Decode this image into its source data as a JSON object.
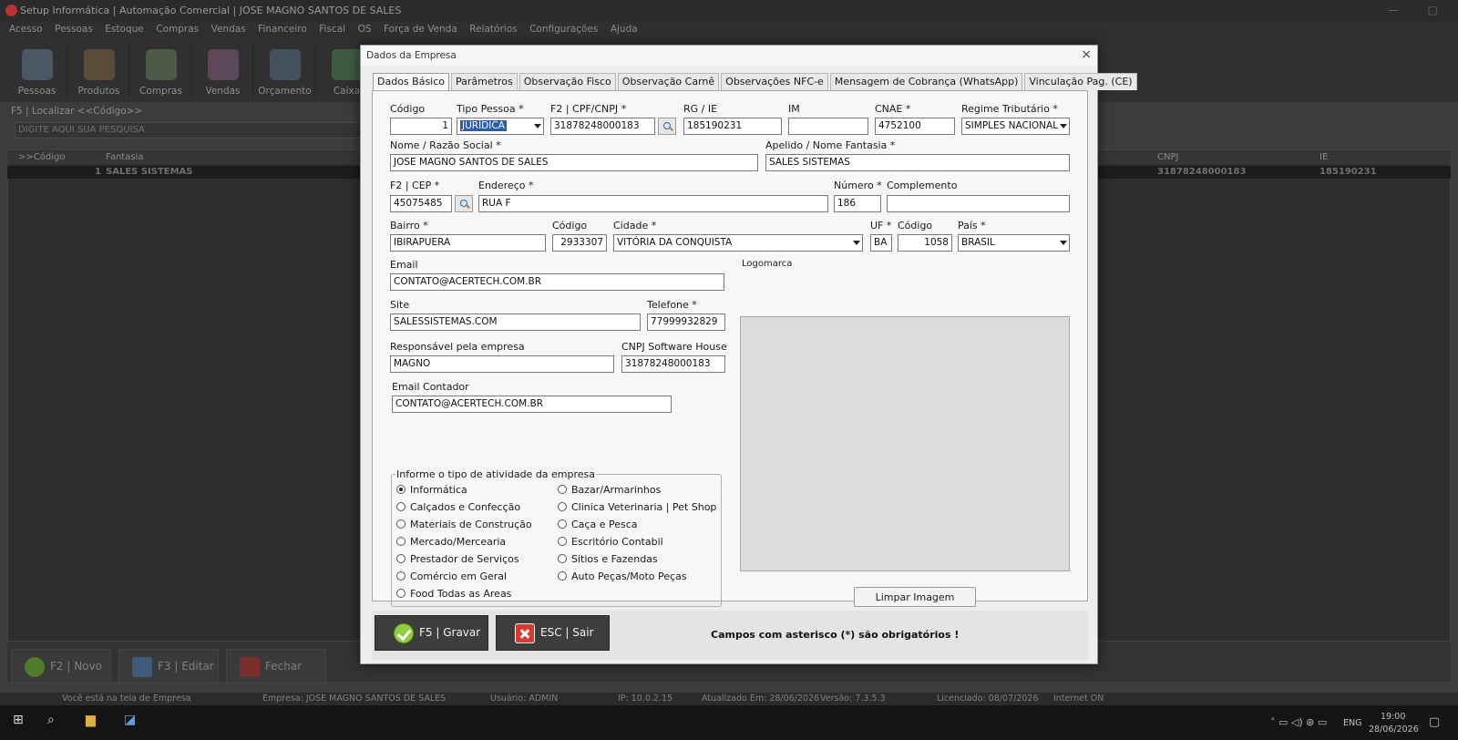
{
  "background_app": {
    "title": "Setup Informática | Automação Comercial | JOSE MAGNO SANTOS DE SALES",
    "window_buttons": "— ▢",
    "menu": [
      "Acesso",
      "Pessoas",
      "Estoque",
      "Compras",
      "Vendas",
      "Financeiro",
      "Fiscal",
      "OS",
      "Força de Venda",
      "Relatórios",
      "Configurações",
      "Ajuda"
    ],
    "toolbar": [
      "Pessoas",
      "Produtos",
      "Compras",
      "Vendas",
      "Orçamento",
      "Caixa"
    ],
    "search_label": "F5 | Localizar <<Código>>",
    "search_placeholder": "DIGITE AQUI SUA PESQUISA",
    "grid_headers": {
      "codigo": ">>Código",
      "fantasia": "Fantasia",
      "cnpj": "CNPJ",
      "ie": "IE"
    },
    "grid_row": {
      "codigo": "1",
      "fantasia": "SALES SISTEMAS",
      "cnpj": "31878248000183",
      "ie": "185190231"
    },
    "bottom_buttons": {
      "novo": "F2 | Novo",
      "editar": "F3 | Editar",
      "fechar": "Fechar"
    },
    "status": {
      "tela": "Você está na tela de Empresa",
      "empresa": "Empresa: JOSE MAGNO SANTOS DE SALES",
      "usuario": "Usuário: ADMIN",
      "ip": "IP: 10.0.2.15",
      "atualizado": "Atualizado Em: 28/06/2026",
      "versao": "Versão: 7.3.5.3",
      "licenciado": "Licenciado: 08/07/2026",
      "internet": "Internet ON"
    }
  },
  "taskbar": {
    "lang": "ENG",
    "time": "19:00",
    "date": "28/06/2026"
  },
  "dialog": {
    "title": "Dados da Empresa",
    "close": "×",
    "tabs": [
      "Dados Básico",
      "Parâmetros",
      "Observação Fisco",
      "Observação Carnê",
      "Observações NFC-e",
      "Mensagem de Cobrança (WhatsApp)",
      "Vinculação Pag. (CE)"
    ],
    "labels": {
      "codigo": "Código",
      "tipo_pessoa": "Tipo Pessoa *",
      "cpf_cnpj": "F2 | CPF/CNPJ *",
      "rg_ie": "RG / IE",
      "im": "IM",
      "cnae": "CNAE *",
      "regime": "Regime Tributário *",
      "razao": "Nome / Razão Social *",
      "fantasia": "Apelido / Nome Fantasia *",
      "cep": "F2 | CEP *",
      "endereco": "Endereço *",
      "numero": "Número *",
      "complemento": "Complemento",
      "bairro": "Bairro *",
      "cod_cidade": "Código",
      "cidade": "Cidade *",
      "uf": "UF *",
      "cod_pais": "Código",
      "pais": "País *",
      "email": "Email",
      "logomarca": "Logomarca",
      "site": "Site",
      "telefone": "Telefone *",
      "responsavel": "Responsável pela empresa",
      "cnpj_sh": "CNPJ Software House",
      "email_contador": "Email Contador"
    },
    "values": {
      "codigo": "1",
      "tipo_pessoa": "JURÍDICA",
      "cpf_cnpj": "31878248000183",
      "rg_ie": "185190231",
      "im": "",
      "cnae": "4752100",
      "regime": "SIMPLES NACIONAL",
      "razao": "JOSE MAGNO SANTOS DE SALES",
      "fantasia": "SALES SISTEMAS",
      "cep": "45075485",
      "endereco": "RUA F",
      "numero": "186",
      "complemento": "",
      "bairro": "IBIRAPUERA",
      "cod_cidade": "2933307",
      "cidade": "VITÓRIA DA CONQUISTA",
      "uf": "BA",
      "cod_pais": "1058",
      "pais": "BRASIL",
      "email": "CONTATO@ACERTECH.COM.BR",
      "site": "SALESSISTEMAS.COM",
      "telefone": "77999932829",
      "responsavel": "MAGNO",
      "cnpj_sh": "31878248000183",
      "email_contador": "CONTATO@ACERTECH.COM.BR"
    },
    "activity": {
      "legend": "Informe o tipo de atividade da empresa",
      "selected": "Informática",
      "col1": [
        "Informática",
        "Calçados e Confecção",
        "Materiais de Construção",
        "Mercado/Mercearia",
        "Prestador de Serviços",
        "Comércio em Geral",
        "Food Todas as Areas"
      ],
      "col2": [
        "Bazar/Armarinhos",
        "Clinica Veterinaria | Pet Shop",
        "Caça e Pesca",
        "Escritório Contabil",
        "Sitios e Fazendas",
        "Auto Peças/Moto Peças"
      ]
    },
    "clear_image": "Limpar Imagem",
    "save": "F5 | Gravar",
    "exit": "ESC | Sair",
    "required_note": "Campos com asterisco (*) são obrigatórios !"
  }
}
